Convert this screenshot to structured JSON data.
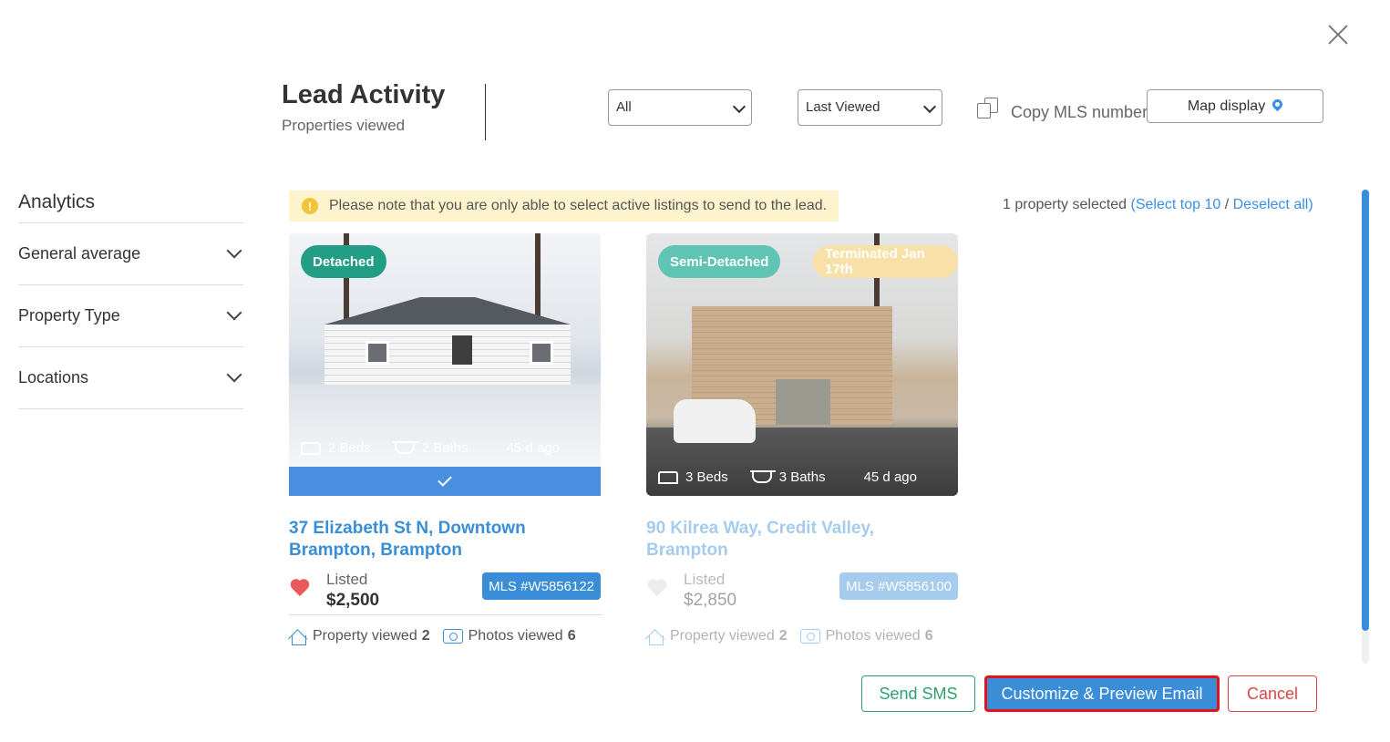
{
  "header": {
    "title": "Lead Activity",
    "subtitle": "Properties viewed",
    "filter_select": "All",
    "sort_select": "Last Viewed",
    "copy_mls_label": "Copy MLS numbers",
    "map_display_label": "Map display"
  },
  "sidebar": {
    "title": "Analytics",
    "items": [
      {
        "label": "General average"
      },
      {
        "label": "Property Type"
      },
      {
        "label": "Locations"
      }
    ]
  },
  "notice": {
    "icon": "!",
    "text": "Please note that you are only able to select active listings to send to the lead."
  },
  "selection": {
    "count_text": "1 property selected",
    "select_top": "(Select top 10",
    "separator": "/",
    "deselect": "Deselect all)"
  },
  "listings": [
    {
      "type_badge": "Detached",
      "beds": "2 Beds",
      "baths": "2 Baths",
      "age": "45 d ago",
      "address": "37 Elizabeth St N, Downtown Brampton, Brampton",
      "listed_label": "Listed",
      "price": "$2,500",
      "mls": "MLS #W5856122",
      "property_viewed_label": "Property viewed",
      "property_viewed_count": "2",
      "photos_viewed_label": "Photos viewed",
      "photos_viewed_count": "6",
      "selected": true,
      "favorited": true
    },
    {
      "type_badge": "Semi-Detached",
      "status_badge": "Terminated Jan 17th",
      "beds": "3 Beds",
      "baths": "3 Baths",
      "age": "45 d ago",
      "address": "90 Kilrea Way, Credit Valley, Brampton",
      "listed_label": "Listed",
      "price": "$2,850",
      "mls": "MLS #W5856100",
      "property_viewed_label": "Property viewed",
      "property_viewed_count": "2",
      "photos_viewed_label": "Photos viewed",
      "photos_viewed_count": "6",
      "selected": false,
      "favorited": false
    }
  ],
  "footer": {
    "send_sms": "Send SMS",
    "customize_email": "Customize & Preview Email",
    "cancel": "Cancel"
  },
  "colors": {
    "accent": "#3a8ed8",
    "sms_green": "#2fa06e",
    "cancel_red": "#e04545",
    "highlight_border": "#e8101a",
    "notice_bg": "#fdf3cd"
  }
}
